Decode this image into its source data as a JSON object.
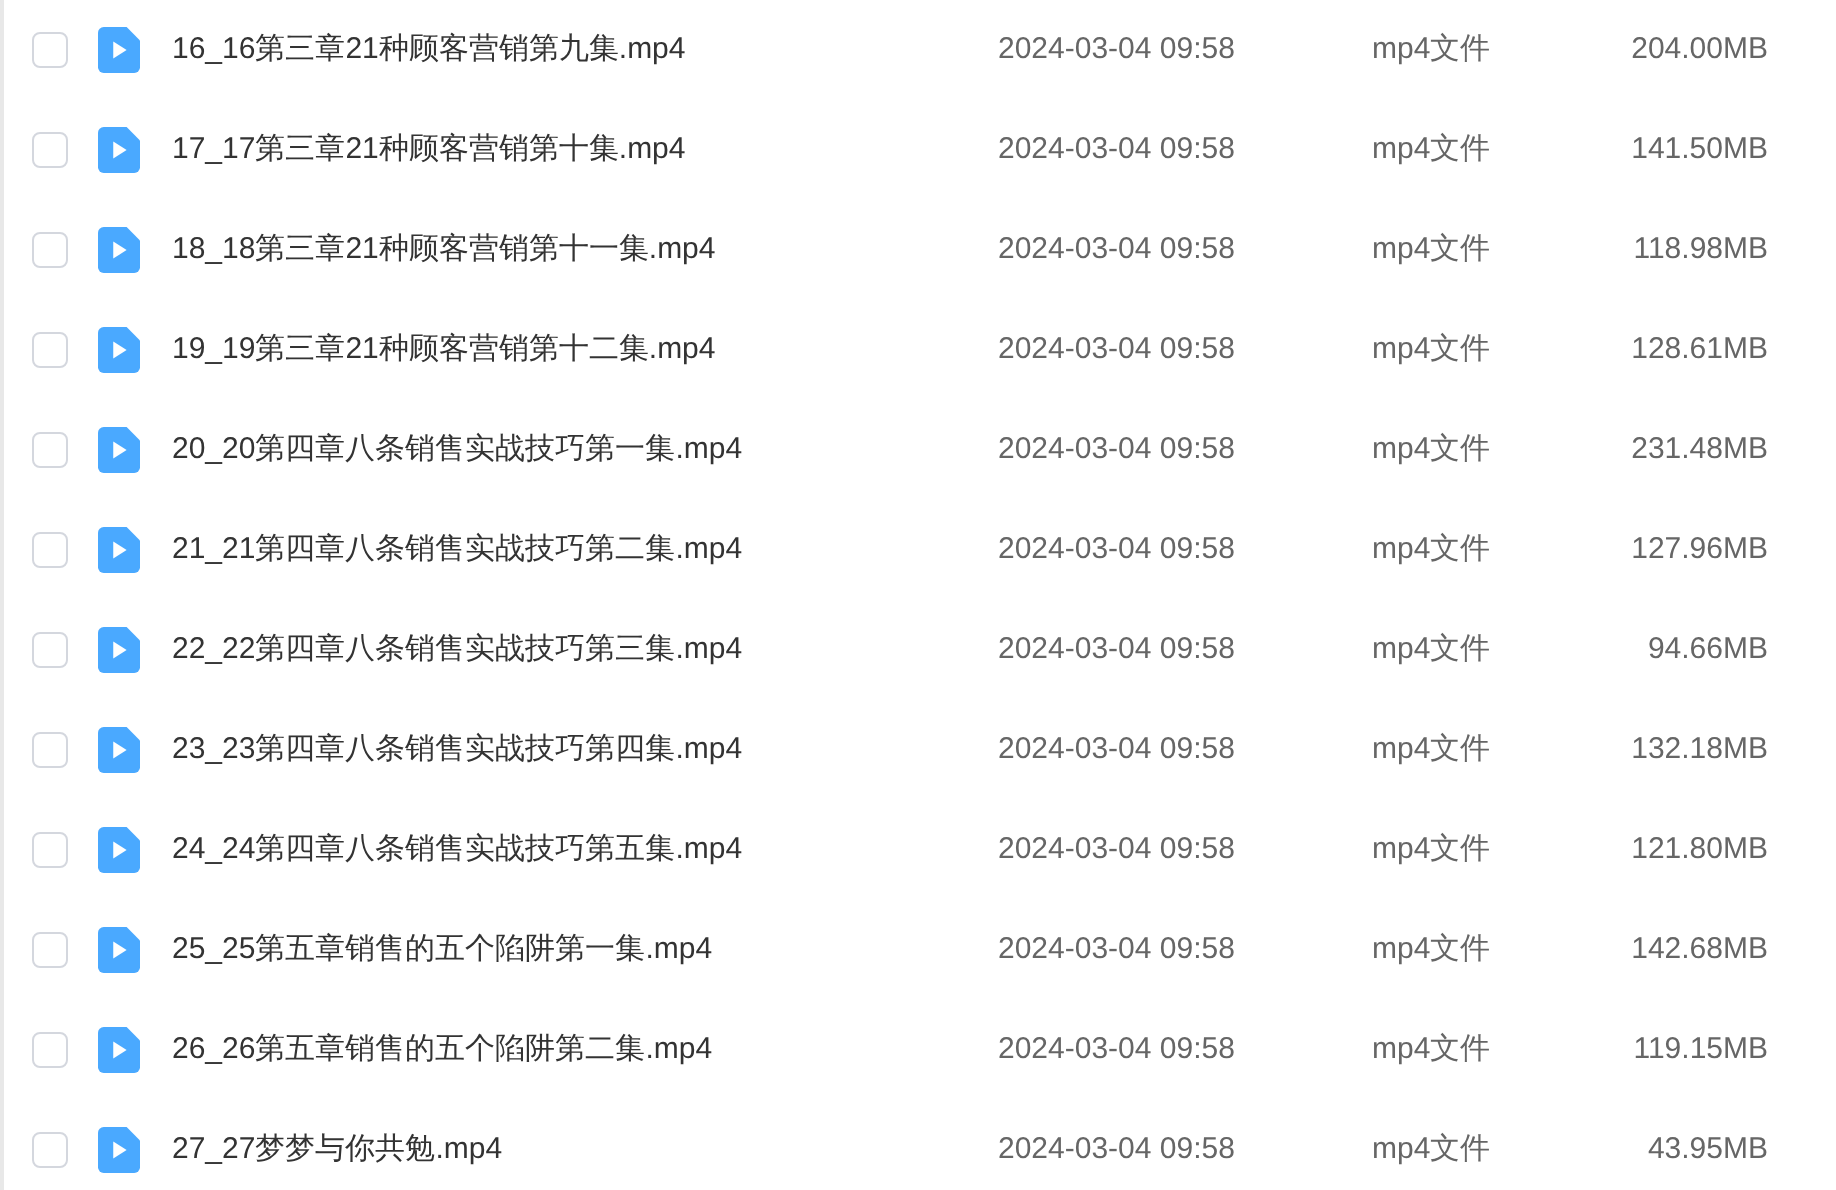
{
  "files": [
    {
      "checked": false,
      "name": "16_16第三章21种顾客营销第九集.mp4",
      "modified": "2024-03-04 09:58",
      "type": "mp4文件",
      "size": "204.00MB"
    },
    {
      "checked": false,
      "name": "17_17第三章21种顾客营销第十集.mp4",
      "modified": "2024-03-04 09:58",
      "type": "mp4文件",
      "size": "141.50MB"
    },
    {
      "checked": false,
      "name": "18_18第三章21种顾客营销第十一集.mp4",
      "modified": "2024-03-04 09:58",
      "type": "mp4文件",
      "size": "118.98MB"
    },
    {
      "checked": false,
      "name": "19_19第三章21种顾客营销第十二集.mp4",
      "modified": "2024-03-04 09:58",
      "type": "mp4文件",
      "size": "128.61MB"
    },
    {
      "checked": false,
      "name": "20_20第四章八条销售实战技巧第一集.mp4",
      "modified": "2024-03-04 09:58",
      "type": "mp4文件",
      "size": "231.48MB"
    },
    {
      "checked": false,
      "name": "21_21第四章八条销售实战技巧第二集.mp4",
      "modified": "2024-03-04 09:58",
      "type": "mp4文件",
      "size": "127.96MB"
    },
    {
      "checked": false,
      "name": "22_22第四章八条销售实战技巧第三集.mp4",
      "modified": "2024-03-04 09:58",
      "type": "mp4文件",
      "size": "94.66MB"
    },
    {
      "checked": false,
      "name": "23_23第四章八条销售实战技巧第四集.mp4",
      "modified": "2024-03-04 09:58",
      "type": "mp4文件",
      "size": "132.18MB"
    },
    {
      "checked": false,
      "name": "24_24第四章八条销售实战技巧第五集.mp4",
      "modified": "2024-03-04 09:58",
      "type": "mp4文件",
      "size": "121.80MB"
    },
    {
      "checked": false,
      "name": "25_25第五章销售的五个陷阱第一集.mp4",
      "modified": "2024-03-04 09:58",
      "type": "mp4文件",
      "size": "142.68MB"
    },
    {
      "checked": false,
      "name": "26_26第五章销售的五个陷阱第二集.mp4",
      "modified": "2024-03-04 09:58",
      "type": "mp4文件",
      "size": "119.15MB"
    },
    {
      "checked": false,
      "name": "27_27梦梦与你共勉.mp4",
      "modified": "2024-03-04 09:58",
      "type": "mp4文件",
      "size": "43.95MB"
    }
  ]
}
